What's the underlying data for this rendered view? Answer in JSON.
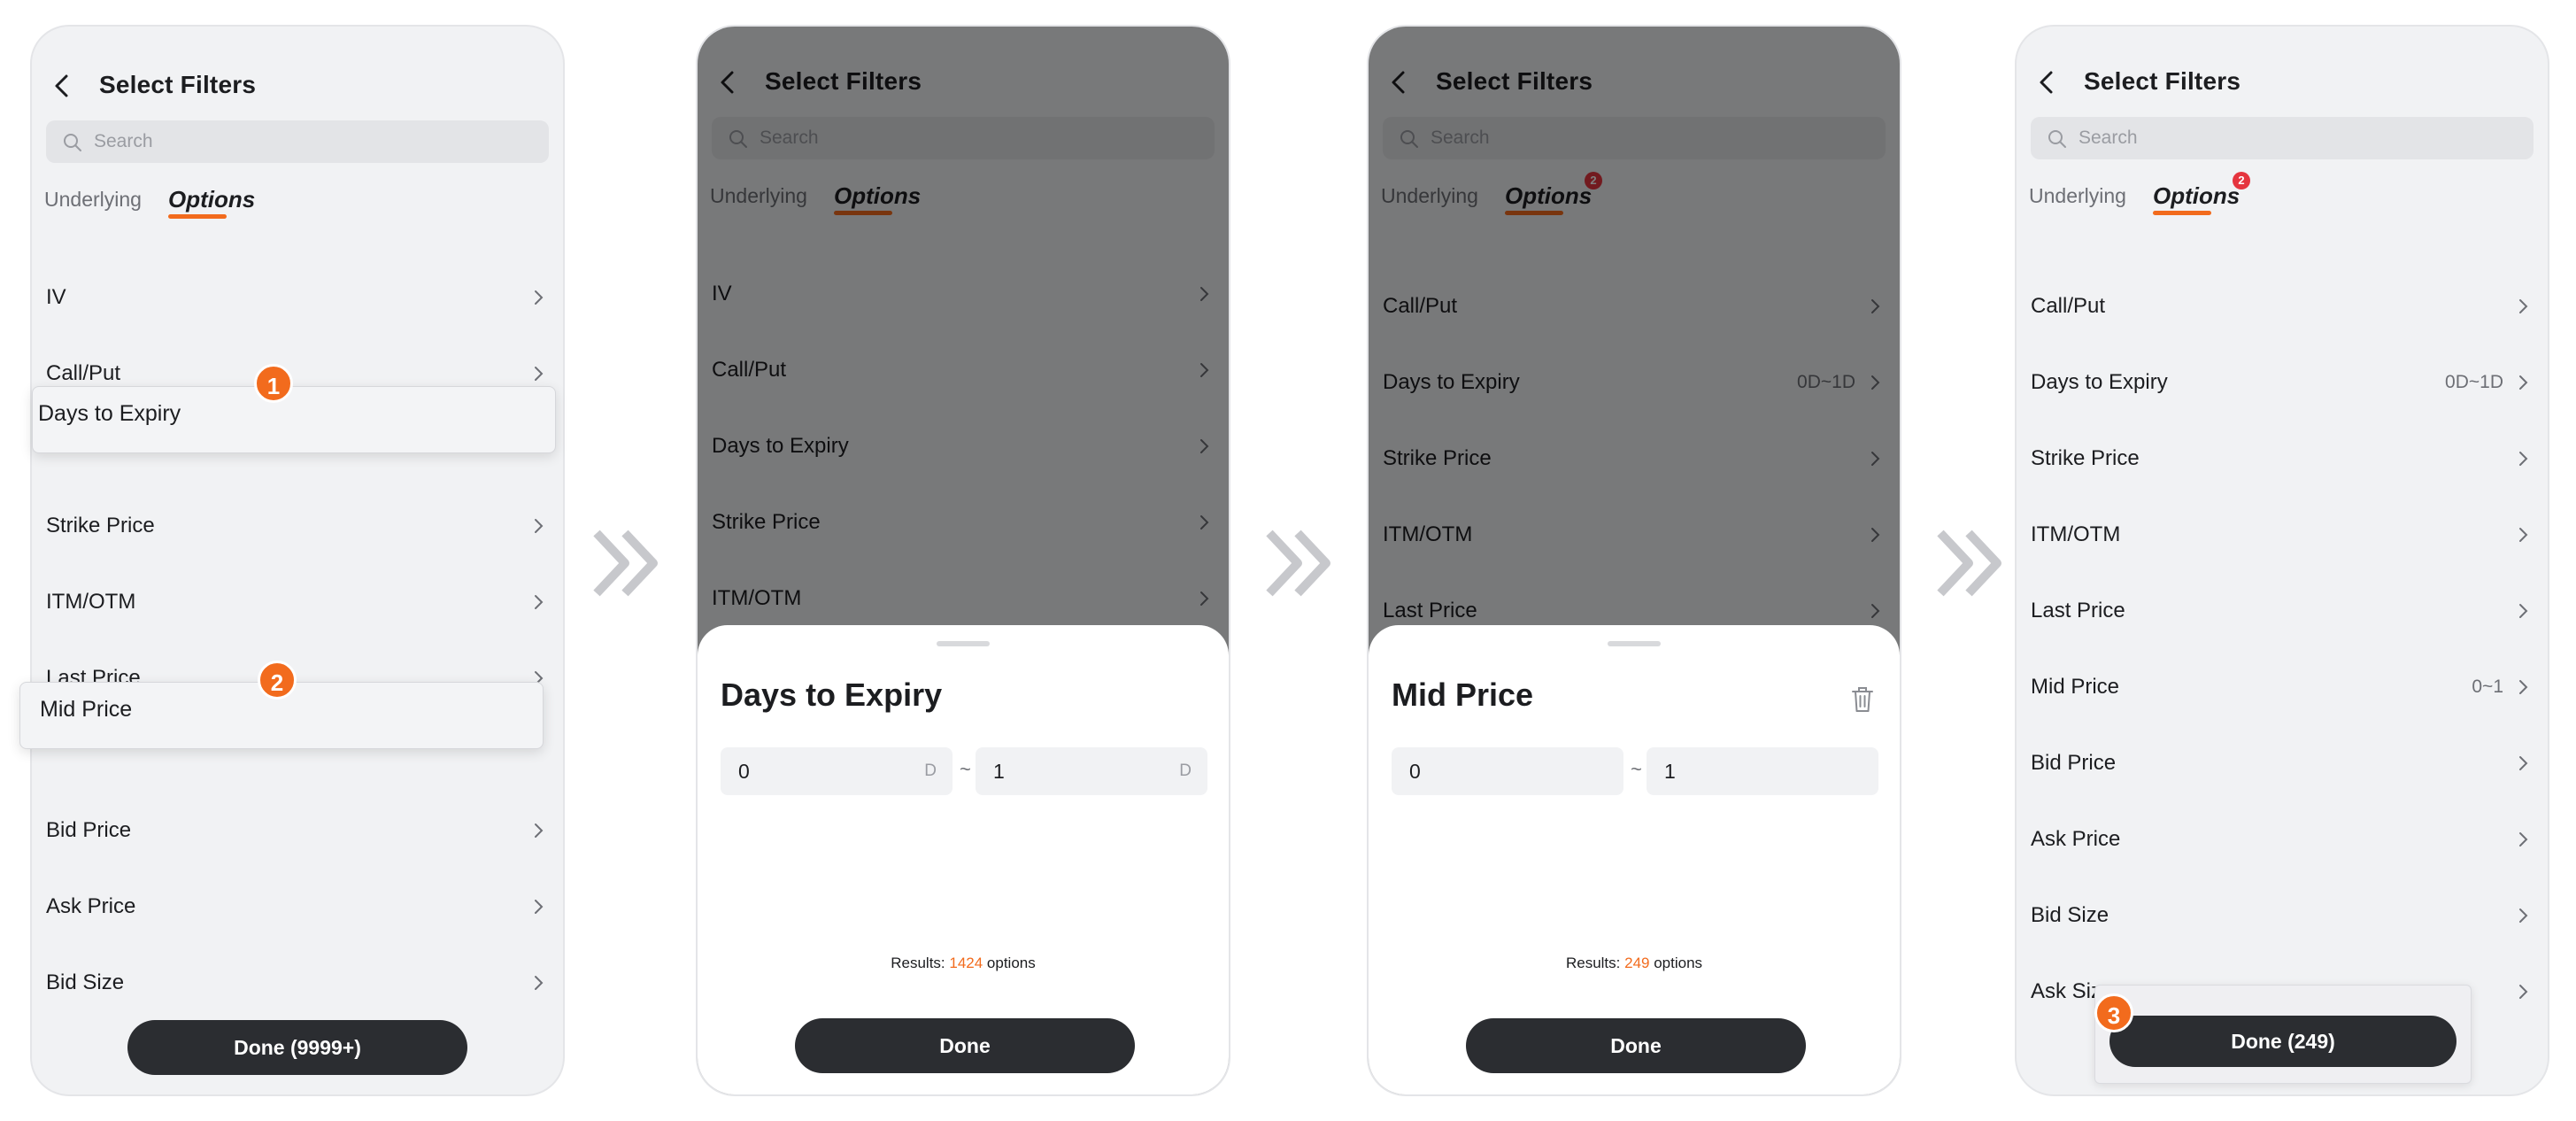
{
  "colors": {
    "accent": "#f26b1d",
    "badge": "#e5353f",
    "button": "#2b2d31",
    "sheet": "#ffffff",
    "background": "#f1f2f4"
  },
  "header": {
    "title": "Select Filters"
  },
  "search": {
    "placeholder": "Search"
  },
  "tabs": {
    "underlying": "Underlying",
    "options": "Options"
  },
  "labels": {
    "iv": "IV",
    "call_put": "Call/Put",
    "days_to_expiry": "Days to Expiry",
    "strike_price": "Strike Price",
    "itm_otm": "ITM/OTM",
    "last_price": "Last Price",
    "mid_price": "Mid Price",
    "bid_price": "Bid Price",
    "ask_price": "Ask Price",
    "bid_size": "Bid Size",
    "ask_size": "Ask Size"
  },
  "screen1": {
    "done_label": "Done (9999+)",
    "steps": [
      "1",
      "2"
    ]
  },
  "screen2": {
    "sheet_title": "Days to Expiry",
    "min_value": "0",
    "max_value": "1",
    "unit": "D",
    "separator": "~",
    "results_prefix": "Results: ",
    "results_count": "1424",
    "results_suffix": " options",
    "done_label": "Done"
  },
  "screen3": {
    "badge": "2",
    "days_value": "0D~1D",
    "sheet_title": "Mid Price",
    "min_value": "0",
    "max_value": "1",
    "separator": "~",
    "results_prefix": "Results: ",
    "results_count": "249",
    "results_suffix": " options",
    "done_label": "Done"
  },
  "screen4": {
    "badge": "2",
    "days_value": "0D~1D",
    "mid_value": "0~1",
    "done_label": "Done (249)",
    "step": "3"
  },
  "icons": {
    "back": "chevron-left-icon",
    "search": "search-icon",
    "chevron": "chevron-right-icon",
    "trash": "trash-icon",
    "step_arrow": "double-chevron-right-icon"
  }
}
